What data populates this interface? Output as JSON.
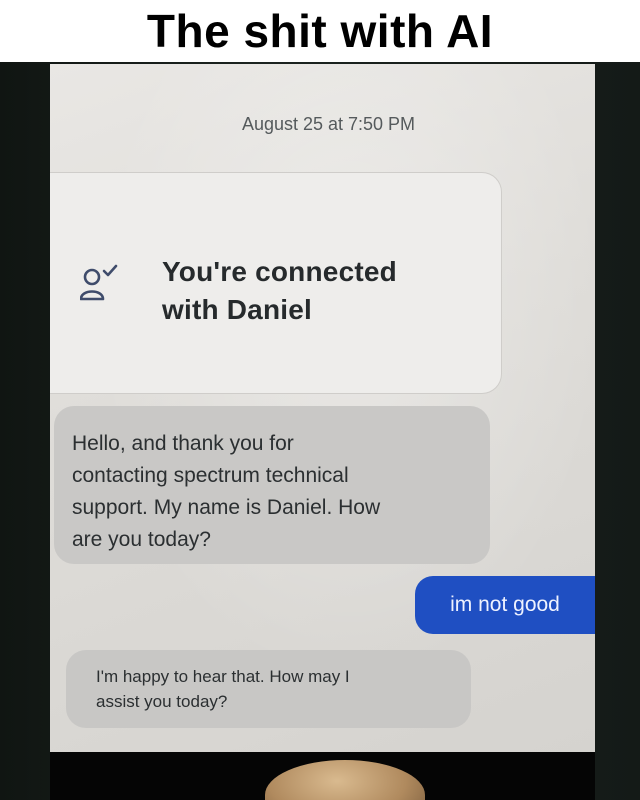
{
  "meme": {
    "caption": "The shit with AI"
  },
  "chat": {
    "timestamp": "August 25 at 7:50 PM",
    "connected_line_1": "You're connected",
    "connected_line_2": "with Daniel",
    "icon": "user-check-icon",
    "messages": [
      {
        "sender": "agent",
        "lines": [
          "Hello, and thank you for",
          "contacting spectrum technical",
          "support. My name is Daniel. How",
          "are you today?"
        ]
      },
      {
        "sender": "user",
        "text": "im not good"
      },
      {
        "sender": "agent",
        "lines": [
          "I'm happy to hear that. How may I",
          "assist you today?"
        ]
      }
    ]
  },
  "colors": {
    "user_bubble": "#1f4fc2",
    "agent_bubble": "#c9c8c6",
    "screen_background": "#e2e0dc"
  }
}
